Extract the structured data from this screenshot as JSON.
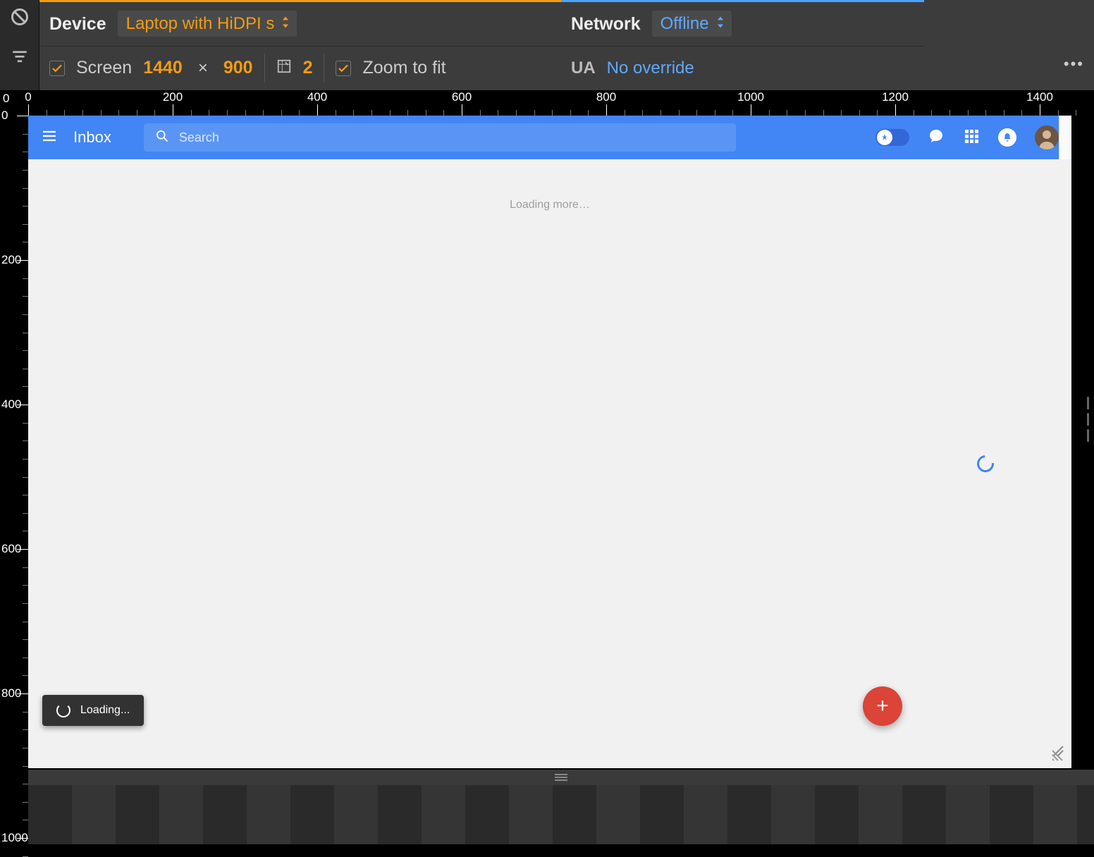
{
  "devtools": {
    "device_label": "Device",
    "device_value": "Laptop with HiDPI s",
    "network_label": "Network",
    "network_value": "Offline",
    "screen_label": "Screen",
    "width": "1440",
    "height": "900",
    "dpr": "2",
    "zoom_label": "Zoom to fit",
    "ua_label": "UA",
    "ua_value": "No override",
    "ruler_origin": "0"
  },
  "app": {
    "title": "Inbox",
    "search_placeholder": "Search",
    "loading_more": "Loading more…",
    "toast": "Loading...",
    "fab": "+"
  },
  "ruler_h": [
    0,
    200,
    400,
    600,
    800,
    1000,
    1200,
    1400
  ],
  "ruler_v": [
    0,
    200,
    400,
    600,
    800,
    1000
  ]
}
